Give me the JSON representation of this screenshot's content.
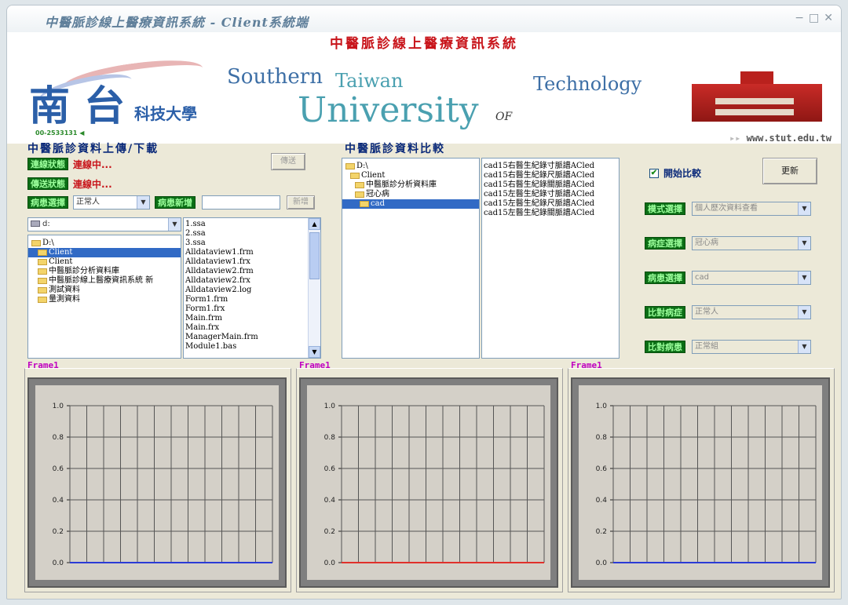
{
  "window": {
    "title": "中醫脈診線上醫療資訊系統 - Client系統端",
    "controls": [
      "−",
      "□",
      "✕"
    ]
  },
  "banner": {
    "heading": "中醫脈診線上醫療資訊系統",
    "logo_main": "南 台",
    "logo_sub": "科技大學",
    "logo_code": "00-2533131 ◀",
    "word_southern": "Southern",
    "word_taiwan": "Taiwan",
    "word_university": "University",
    "word_of": "OF",
    "word_technology": "Technology",
    "url_prefix": "▸▸ ",
    "url": "www.stut.edu.tw"
  },
  "upload": {
    "section_title": "中醫脈診資料上傳/下載",
    "conn_label": "連線狀態",
    "conn_value": "連線中...",
    "transfer_label": "傳送狀態",
    "transfer_value": "連線中...",
    "connect_btn": "傳送",
    "patient_label": "病患選擇",
    "patient_value": "正常人",
    "new_label": "病患新增",
    "new_value": "",
    "add_btn": "新增",
    "drive_value": "d:",
    "dir_tree": [
      {
        "name": "D:\\",
        "selected": false,
        "indent": 0
      },
      {
        "name": "Client",
        "selected": true,
        "indent": 1
      },
      {
        "name": "Client",
        "selected": false,
        "indent": 1
      },
      {
        "name": "中醫脈診分析資料庫",
        "selected": false,
        "indent": 1
      },
      {
        "name": "中醫脈診線上醫療資訊系統 新",
        "selected": false,
        "indent": 1
      },
      {
        "name": "測試資料",
        "selected": false,
        "indent": 1
      },
      {
        "name": "量測資料",
        "selected": false,
        "indent": 1
      }
    ],
    "files": [
      "1.ssa",
      "2.ssa",
      "3.ssa",
      "Alldataview1.frm",
      "Alldataview1.frx",
      "Alldataview2.frm",
      "Alldataview2.frx",
      "Alldataview2.log",
      "Form1.frm",
      "Form1.frx",
      "Main.frm",
      "Main.frx",
      "ManagerMain.frm",
      "Module1.bas"
    ]
  },
  "compare": {
    "section_title": "中醫脈診資料比較",
    "dir_tree": [
      {
        "name": "D:\\",
        "selected": false,
        "indent": 0
      },
      {
        "name": "Client",
        "selected": false,
        "indent": 1
      },
      {
        "name": "中醫脈診分析資料庫",
        "selected": false,
        "indent": 2
      },
      {
        "name": "冠心病",
        "selected": false,
        "indent": 2
      },
      {
        "name": "cad",
        "selected": true,
        "indent": 3
      }
    ],
    "files": [
      "cad15右醫生紀錄寸脈譜ACled",
      "cad15右醫生紀錄尺脈譜ACled",
      "cad15右醫生紀錄關脈譜ACled",
      "cad15左醫生紀錄寸脈譜ACled",
      "cad15左醫生紀錄尺脈譜ACled",
      "cad15左醫生紀錄關脈譜ACled"
    ],
    "start_label": "開始比較",
    "start_checked": "✔",
    "update_btn": "更新",
    "selectors": [
      {
        "label": "模式選擇",
        "value": "個人歷次資料查看"
      },
      {
        "label": "病症選擇",
        "value": "冠心病"
      },
      {
        "label": "病患選擇",
        "value": "cad"
      },
      {
        "label": "比對病症",
        "value": "正常人"
      },
      {
        "label": "比對病患",
        "value": "正常組"
      }
    ]
  },
  "frames": [
    {
      "label": "Frame1",
      "line_color": "#2a3bd6"
    },
    {
      "label": "Frame1",
      "line_color": "#e0302b"
    },
    {
      "label": "Frame1",
      "line_color": "#2a3bd6"
    }
  ],
  "chart_data": [
    {
      "type": "line",
      "title": "",
      "xlabel": "",
      "ylabel": "",
      "ylim": [
        0,
        1.0
      ],
      "y_ticks": [
        "1.0",
        "0.8",
        "0.6",
        "0.4",
        "0.2",
        "0.0"
      ],
      "series": [
        {
          "values": [
            0,
            0,
            0,
            0,
            0,
            0,
            0,
            0,
            0,
            0,
            0,
            0,
            0
          ]
        }
      ],
      "grid": true
    },
    {
      "type": "line",
      "title": "",
      "xlabel": "",
      "ylabel": "",
      "ylim": [
        0,
        1.0
      ],
      "y_ticks": [
        "1.0",
        "0.8",
        "0.6",
        "0.4",
        "0.2",
        "0.0"
      ],
      "series": [
        {
          "values": [
            0,
            0,
            0,
            0,
            0,
            0,
            0,
            0,
            0,
            0,
            0,
            0,
            0
          ]
        }
      ],
      "grid": true
    },
    {
      "type": "line",
      "title": "",
      "xlabel": "",
      "ylabel": "",
      "ylim": [
        0,
        1.0
      ],
      "y_ticks": [
        "1.0",
        "0.8",
        "0.6",
        "0.4",
        "0.2",
        "0.0"
      ],
      "series": [
        {
          "values": [
            0,
            0,
            0,
            0,
            0,
            0,
            0,
            0,
            0,
            0,
            0,
            0,
            0
          ]
        }
      ],
      "grid": true
    }
  ]
}
